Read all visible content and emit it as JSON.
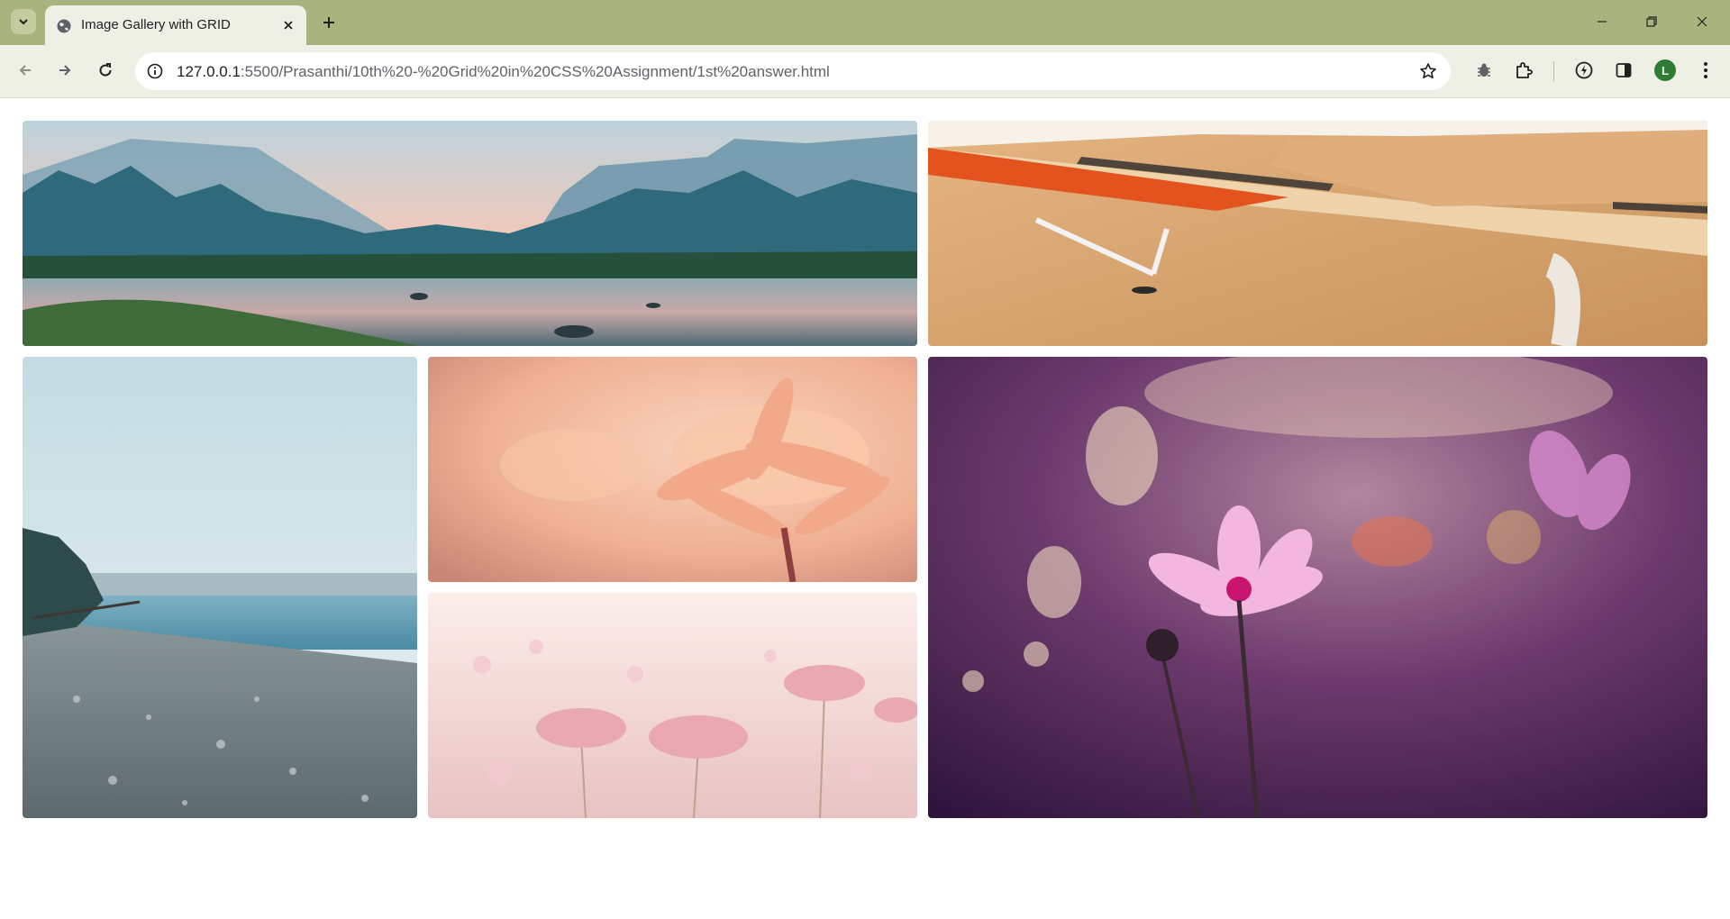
{
  "browser": {
    "tab_title": "Image Gallery with GRID",
    "url_host": "127.0.0.1",
    "url_rest": ":5500/Prasanthi/10th%20-%20Grid%20in%20CSS%20Assignment/1st%20answer.html",
    "profile_initial": "L",
    "icons": [
      "chevron-down-icon",
      "globe-icon",
      "close-icon",
      "plus-icon",
      "minimize-icon",
      "restore-icon",
      "back-icon",
      "forward-icon",
      "reload-icon",
      "info-icon",
      "star-icon",
      "bug-icon",
      "puzzle-icon",
      "performance-icon",
      "sidepanel-icon",
      "more-vertical-icon"
    ]
  },
  "gallery": {
    "images": [
      {
        "name": "misty-mountain-river",
        "palette": [
          "#f2c4b4",
          "#5b8da3",
          "#1f5265"
        ]
      },
      {
        "name": "wooden-desk-tablet",
        "palette": [
          "#d9a66f",
          "#e0531f",
          "#f4efe6"
        ]
      },
      {
        "name": "pebble-beach-shore",
        "palette": [
          "#c9dde6",
          "#6aa4b8",
          "#8d8f8c"
        ]
      },
      {
        "name": "peach-dahlia-closeup",
        "palette": [
          "#f6c3a5",
          "#e9a07e",
          "#b86458"
        ]
      },
      {
        "name": "pink-flower-field",
        "palette": [
          "#fbe9e4",
          "#eab9bf",
          "#c98f8f"
        ]
      },
      {
        "name": "purple-cosmos-bokeh",
        "palette": [
          "#5d2b5e",
          "#b25a93",
          "#e9b0d8"
        ]
      }
    ]
  }
}
